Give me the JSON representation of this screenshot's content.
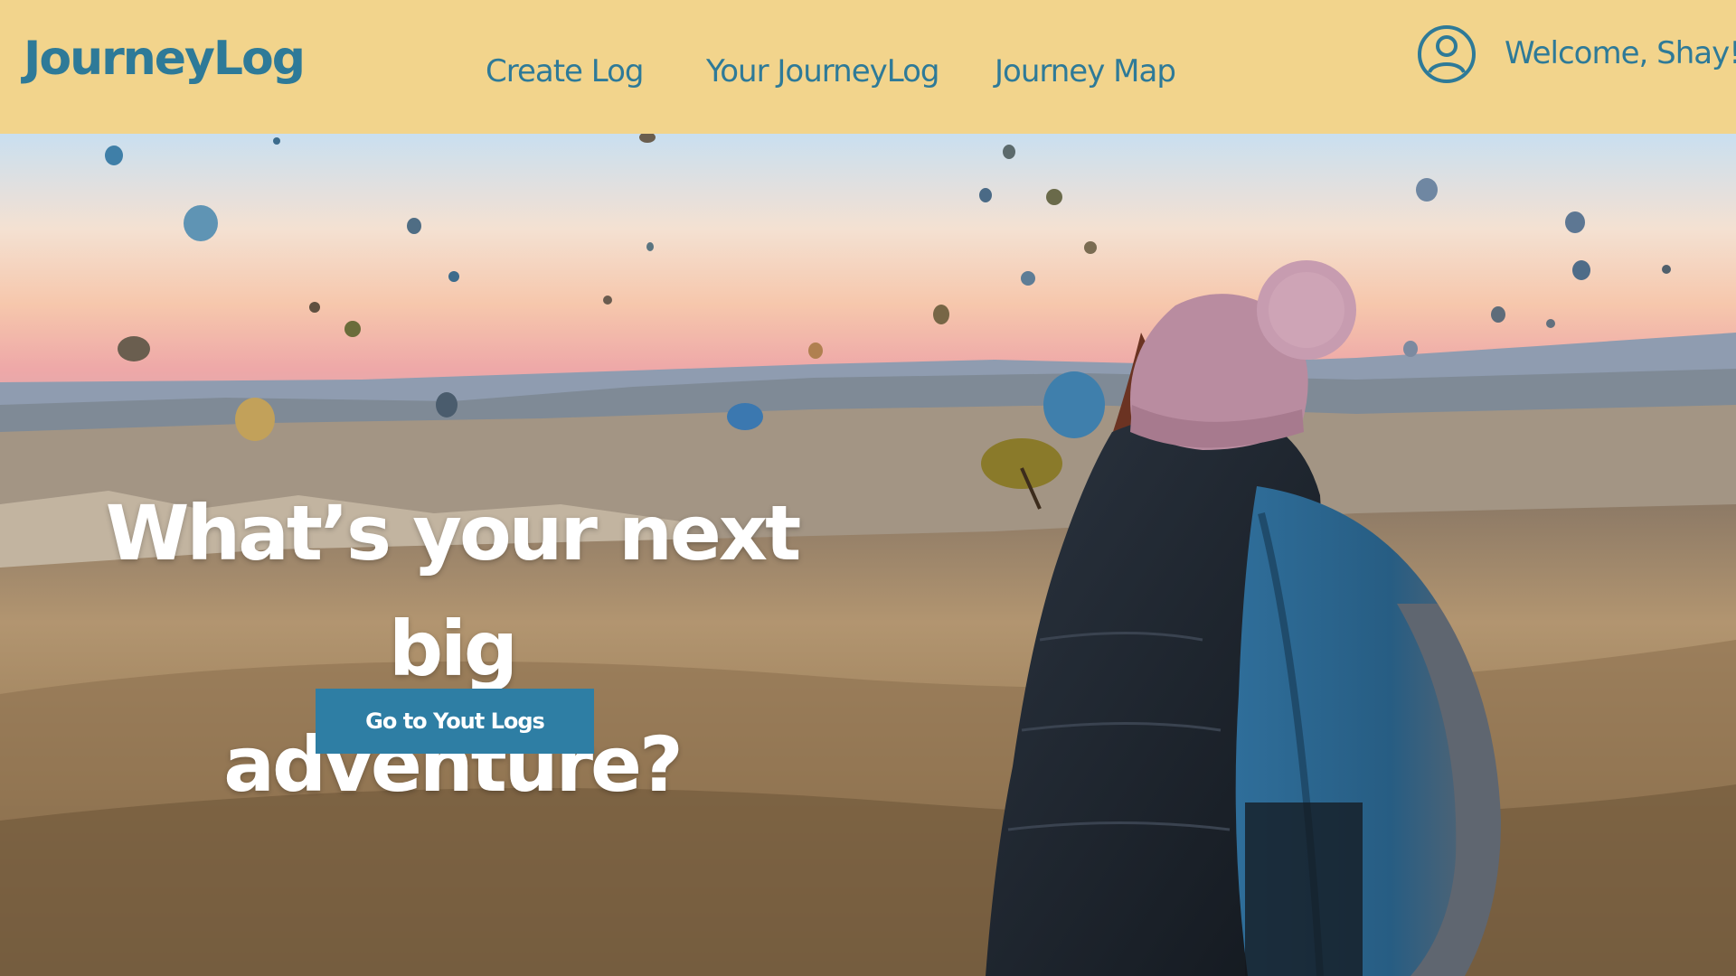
{
  "header": {
    "logo": "JourneyLog",
    "nav": [
      {
        "label": "Create Log"
      },
      {
        "label": "Your JourneyLog"
      },
      {
        "label": "Journey Map"
      }
    ],
    "user": {
      "icon": "user-profile-icon",
      "welcome": "Welcome, Shay!"
    }
  },
  "hero": {
    "image": "hot-air-balloons-traveler-photo",
    "headline_line1": "What’s your next big",
    "headline_line2": "adventure?",
    "cta_label": "Go to Yout Logs"
  },
  "colors": {
    "header_bg": "#f2d48c",
    "brand_blue": "#2e7a98",
    "button_bg": "#2e7ea4"
  }
}
